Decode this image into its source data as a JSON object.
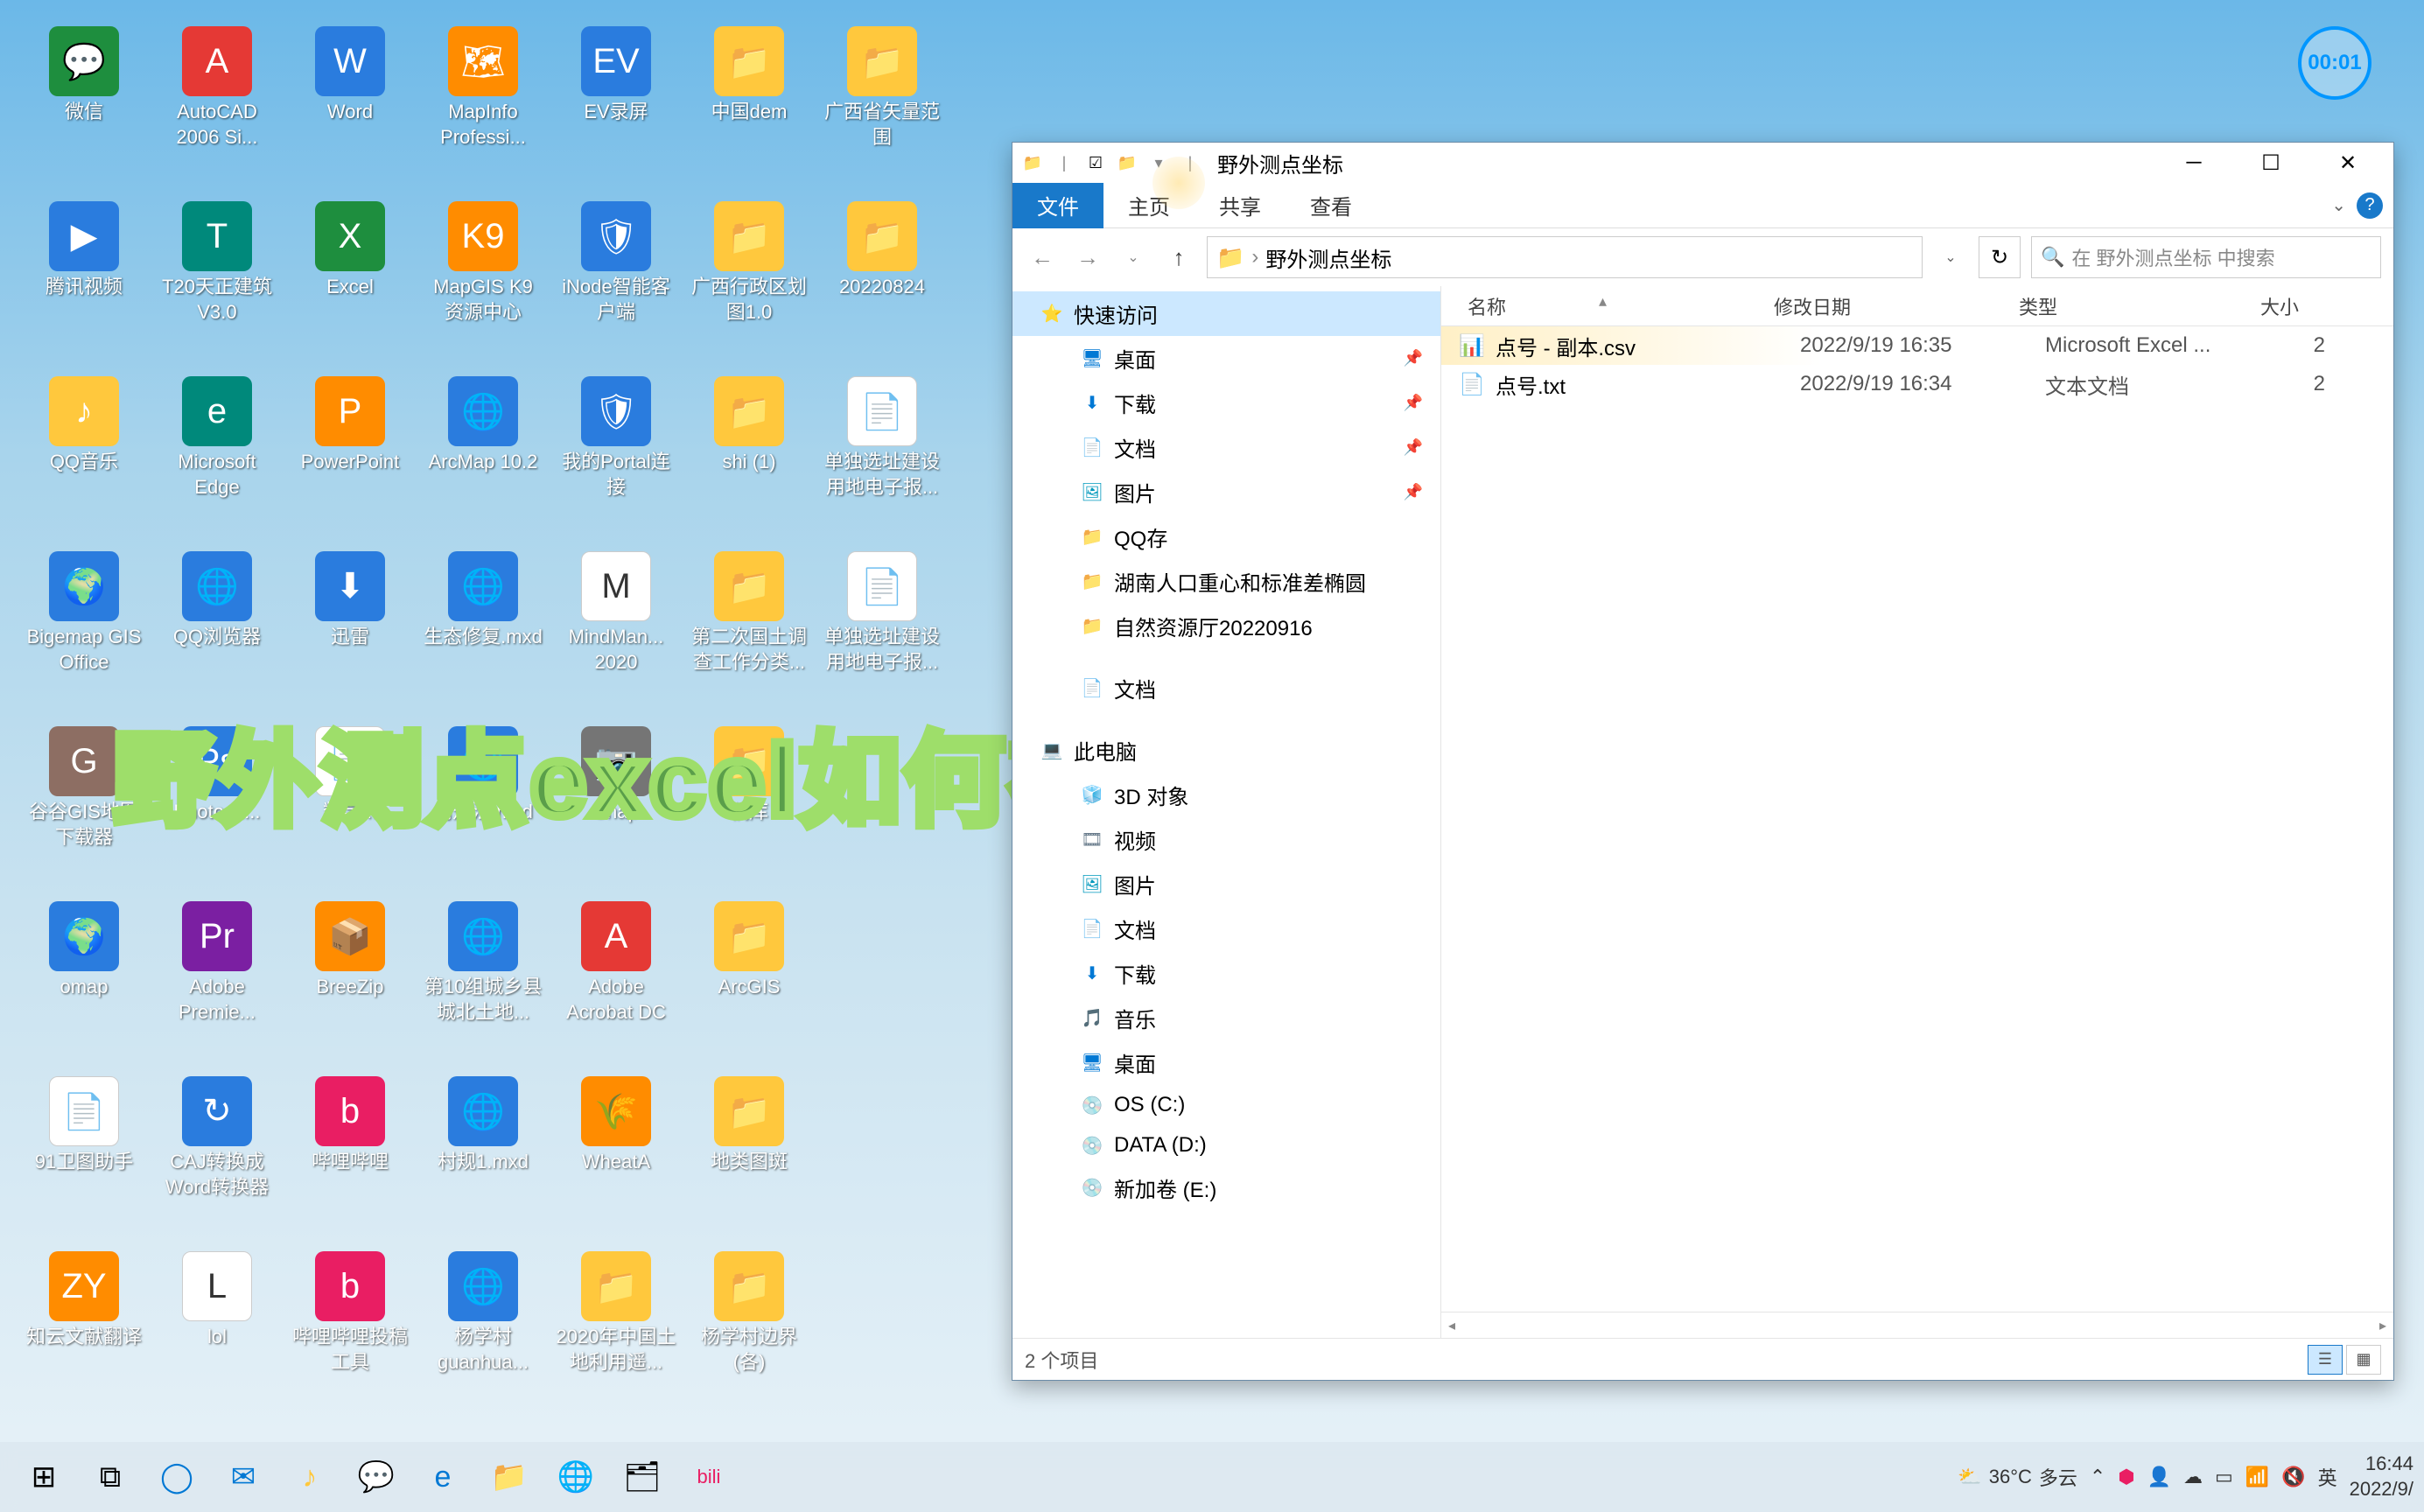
{
  "timer": "00:01",
  "overlay": "野外测点excel如何在ArcGIS中展点",
  "desktop": {
    "icons": [
      {
        "label": "微信",
        "c": "c-green",
        "g": "💬"
      },
      {
        "label": "AutoCAD 2006 Si...",
        "c": "c-red",
        "g": "A"
      },
      {
        "label": "Word",
        "c": "c-blue",
        "g": "W"
      },
      {
        "label": "MapInfo Professi...",
        "c": "c-orange",
        "g": "🗺"
      },
      {
        "label": "EV录屏",
        "c": "c-blue",
        "g": "EV"
      },
      {
        "label": "中国dem",
        "c": "c-yellow",
        "g": "📁"
      },
      {
        "label": "广西省矢量范围",
        "c": "c-yellow",
        "g": "📁"
      },
      {
        "label": "",
        "c": "",
        "g": ""
      },
      {
        "label": "腾讯视频",
        "c": "c-blue",
        "g": "▶"
      },
      {
        "label": "T20天正建筑V3.0",
        "c": "c-teal",
        "g": "T"
      },
      {
        "label": "Excel",
        "c": "c-green",
        "g": "X"
      },
      {
        "label": "MapGIS K9 资源中心",
        "c": "c-orange",
        "g": "K9"
      },
      {
        "label": "iNode智能客户端",
        "c": "c-blue",
        "g": "🛡"
      },
      {
        "label": "广西行政区划图1.0",
        "c": "c-yellow",
        "g": "📁"
      },
      {
        "label": "20220824",
        "c": "c-yellow",
        "g": "📁"
      },
      {
        "label": "",
        "c": "",
        "g": ""
      },
      {
        "label": "QQ音乐",
        "c": "c-yellow",
        "g": "♪"
      },
      {
        "label": "Microsoft Edge",
        "c": "c-teal",
        "g": "e"
      },
      {
        "label": "PowerPoint",
        "c": "c-orange",
        "g": "P"
      },
      {
        "label": "ArcMap 10.2",
        "c": "c-blue",
        "g": "🌐"
      },
      {
        "label": "我的Portal连接",
        "c": "c-blue",
        "g": "🛡"
      },
      {
        "label": "shi (1)",
        "c": "c-yellow",
        "g": "📁"
      },
      {
        "label": "单独选址建设用地电子报...",
        "c": "c-white",
        "g": "📄"
      },
      {
        "label": "",
        "c": "",
        "g": ""
      },
      {
        "label": "Bigemap GIS Office",
        "c": "c-blue",
        "g": "🌍"
      },
      {
        "label": "QQ浏览器",
        "c": "c-blue",
        "g": "🌐"
      },
      {
        "label": "迅雷",
        "c": "c-blue",
        "g": "⬇"
      },
      {
        "label": "生态修复.mxd",
        "c": "c-blue",
        "g": "🌐"
      },
      {
        "label": "MindMan... 2020",
        "c": "c-white",
        "g": "M"
      },
      {
        "label": "第二次国土调查工作分类...",
        "c": "c-yellow",
        "g": "📁"
      },
      {
        "label": "单独选址建设用地电子报...",
        "c": "c-white",
        "g": "📄"
      },
      {
        "label": "",
        "c": "",
        "g": ""
      },
      {
        "label": "谷谷GIS地图下载器",
        "c": "c-brown",
        "g": "G"
      },
      {
        "label": "Photosh...",
        "c": "c-blue",
        "g": "Ps"
      },
      {
        "label": "数学...",
        "c": "c-white",
        "g": "📄"
      },
      {
        "label": "用规法.mxd",
        "c": "c-blue",
        "g": "🌐"
      },
      {
        "label": "Snap",
        "c": "c-gray",
        "g": "📷"
      },
      {
        "label": "稿库",
        "c": "c-yellow",
        "g": "📁"
      },
      {
        "label": "",
        "c": "",
        "g": ""
      },
      {
        "label": "",
        "c": "",
        "g": ""
      },
      {
        "label": "omap",
        "c": "c-blue",
        "g": "🌍"
      },
      {
        "label": "Adobe Premie...",
        "c": "c-purple",
        "g": "Pr"
      },
      {
        "label": "BreeZip",
        "c": "c-orange",
        "g": "📦"
      },
      {
        "label": "第10组城乡县城北土地...",
        "c": "c-blue",
        "g": "🌐"
      },
      {
        "label": "Adobe Acrobat DC",
        "c": "c-red",
        "g": "A"
      },
      {
        "label": "ArcGIS",
        "c": "c-yellow",
        "g": "📁"
      },
      {
        "label": "",
        "c": "",
        "g": ""
      },
      {
        "label": "",
        "c": "",
        "g": ""
      },
      {
        "label": "91卫图助手",
        "c": "c-white",
        "g": "📄"
      },
      {
        "label": "CAJ转换成Word转换器",
        "c": "c-blue",
        "g": "↻"
      },
      {
        "label": "哔哩哔哩",
        "c": "c-pink",
        "g": "b"
      },
      {
        "label": "村规1.mxd",
        "c": "c-blue",
        "g": "🌐"
      },
      {
        "label": "WheatA",
        "c": "c-orange",
        "g": "🌾"
      },
      {
        "label": "地类图斑",
        "c": "c-yellow",
        "g": "📁"
      },
      {
        "label": "",
        "c": "",
        "g": ""
      },
      {
        "label": "",
        "c": "",
        "g": ""
      },
      {
        "label": "知云文献翻译",
        "c": "c-orange",
        "g": "ZY"
      },
      {
        "label": "lol",
        "c": "c-white",
        "g": "L"
      },
      {
        "label": "哔哩哔哩投稿工具",
        "c": "c-pink",
        "g": "b"
      },
      {
        "label": "杨学村guanhua...",
        "c": "c-blue",
        "g": "🌐"
      },
      {
        "label": "2020年中国土地利用遥...",
        "c": "c-yellow",
        "g": "📁"
      },
      {
        "label": "杨学村边界(各)",
        "c": "c-yellow",
        "g": "📁"
      }
    ]
  },
  "explorer": {
    "title": "野外测点坐标",
    "tabs": {
      "file": "文件",
      "home": "主页",
      "share": "共享",
      "view": "查看"
    },
    "address": "野外测点坐标",
    "search_placeholder": "在 野外测点坐标 中搜索",
    "columns": {
      "name": "名称",
      "date": "修改日期",
      "type": "类型",
      "size": "大小"
    },
    "sidebar": [
      {
        "lvl": 1,
        "icon": "⭐",
        "label": "快速访问",
        "sel": true
      },
      {
        "lvl": 2,
        "icon": "🖥",
        "label": "桌面",
        "pin": true,
        "color": "#0078d4"
      },
      {
        "lvl": 2,
        "icon": "⬇",
        "label": "下载",
        "pin": true,
        "color": "#0078d4"
      },
      {
        "lvl": 2,
        "icon": "📄",
        "label": "文档",
        "pin": true,
        "color": "#657889"
      },
      {
        "lvl": 2,
        "icon": "🖼",
        "label": "图片",
        "pin": true,
        "color": "#0099bc"
      },
      {
        "lvl": 2,
        "icon": "📁",
        "label": "QQ存",
        "color": "#ffc83d"
      },
      {
        "lvl": 2,
        "icon": "📁",
        "label": "湖南人口重心和标准差椭圆",
        "color": "#ffc83d"
      },
      {
        "lvl": 2,
        "icon": "📁",
        "label": "自然资源厅20220916",
        "color": "#ffc83d"
      },
      {
        "lvl": 0,
        "spacer": true
      },
      {
        "lvl": 2,
        "icon": "📄",
        "label": "文档",
        "color": "#657889"
      },
      {
        "lvl": 0,
        "spacer": true
      },
      {
        "lvl": 1,
        "icon": "💻",
        "label": "此电脑",
        "color": "#0078d4"
      },
      {
        "lvl": 2,
        "icon": "🧊",
        "label": "3D 对象",
        "color": "#0099bc"
      },
      {
        "lvl": 2,
        "icon": "🎞",
        "label": "视频",
        "color": "#657889"
      },
      {
        "lvl": 2,
        "icon": "🖼",
        "label": "图片",
        "color": "#0099bc"
      },
      {
        "lvl": 2,
        "icon": "📄",
        "label": "文档",
        "color": "#657889"
      },
      {
        "lvl": 2,
        "icon": "⬇",
        "label": "下载",
        "color": "#0078d4"
      },
      {
        "lvl": 2,
        "icon": "🎵",
        "label": "音乐",
        "color": "#0078d4"
      },
      {
        "lvl": 2,
        "icon": "🖥",
        "label": "桌面",
        "color": "#0078d4"
      },
      {
        "lvl": 2,
        "icon": "💿",
        "label": "OS (C:)",
        "color": "#657889"
      },
      {
        "lvl": 2,
        "icon": "💿",
        "label": "DATA (D:)",
        "color": "#657889"
      },
      {
        "lvl": 2,
        "icon": "💿",
        "label": "新加卷 (E:)",
        "color": "#657889"
      }
    ],
    "files": [
      {
        "icon": "📊",
        "name": "点号 - 副本.csv",
        "date": "2022/9/19 16:35",
        "type": "Microsoft Excel ...",
        "size": "2",
        "hilite": true
      },
      {
        "icon": "📄",
        "name": "点号.txt",
        "date": "2022/9/19 16:34",
        "type": "文本文档",
        "size": "2"
      }
    ],
    "status": "2 个项目"
  },
  "taskbar": {
    "weather": {
      "temp": "36°C",
      "desc": "多云"
    },
    "ime": "英",
    "time": "16:44",
    "date": "2022/9/"
  }
}
